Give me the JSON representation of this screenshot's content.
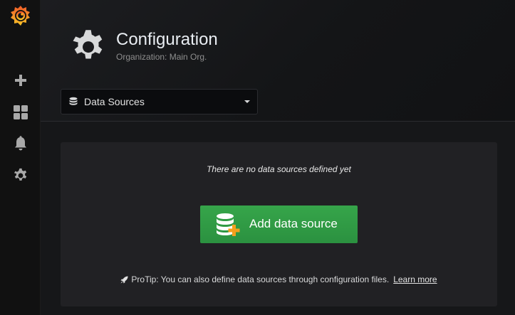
{
  "sidebar": {
    "items": [
      {
        "name": "grafana-logo",
        "icon": "grafana-logo-icon"
      },
      {
        "name": "create",
        "icon": "plus-icon"
      },
      {
        "name": "dashboards",
        "icon": "grid-icon"
      },
      {
        "name": "alerting",
        "icon": "bell-icon"
      },
      {
        "name": "configuration",
        "icon": "gear-icon"
      }
    ]
  },
  "header": {
    "icon": "gear-icon",
    "title": "Configuration",
    "subtitle": "Organization: Main Org."
  },
  "nav_select": {
    "icon": "database-icon",
    "selected": "Data Sources"
  },
  "empty_state": {
    "message": "There are no data sources defined yet",
    "button_label": "Add data source",
    "button_icon": "database-plus-icon",
    "protip_icon": "rocket-icon",
    "protip_text": "ProTip: You can also define data sources through configuration files.",
    "learn_more": "Learn more"
  },
  "colors": {
    "sidebar_bg": "#111111",
    "page_bg": "#161719",
    "card_bg": "#212124",
    "primary_button": "#2f9a44",
    "logo_orange": "#f05a28",
    "plus_orange": "#f4a01d"
  }
}
